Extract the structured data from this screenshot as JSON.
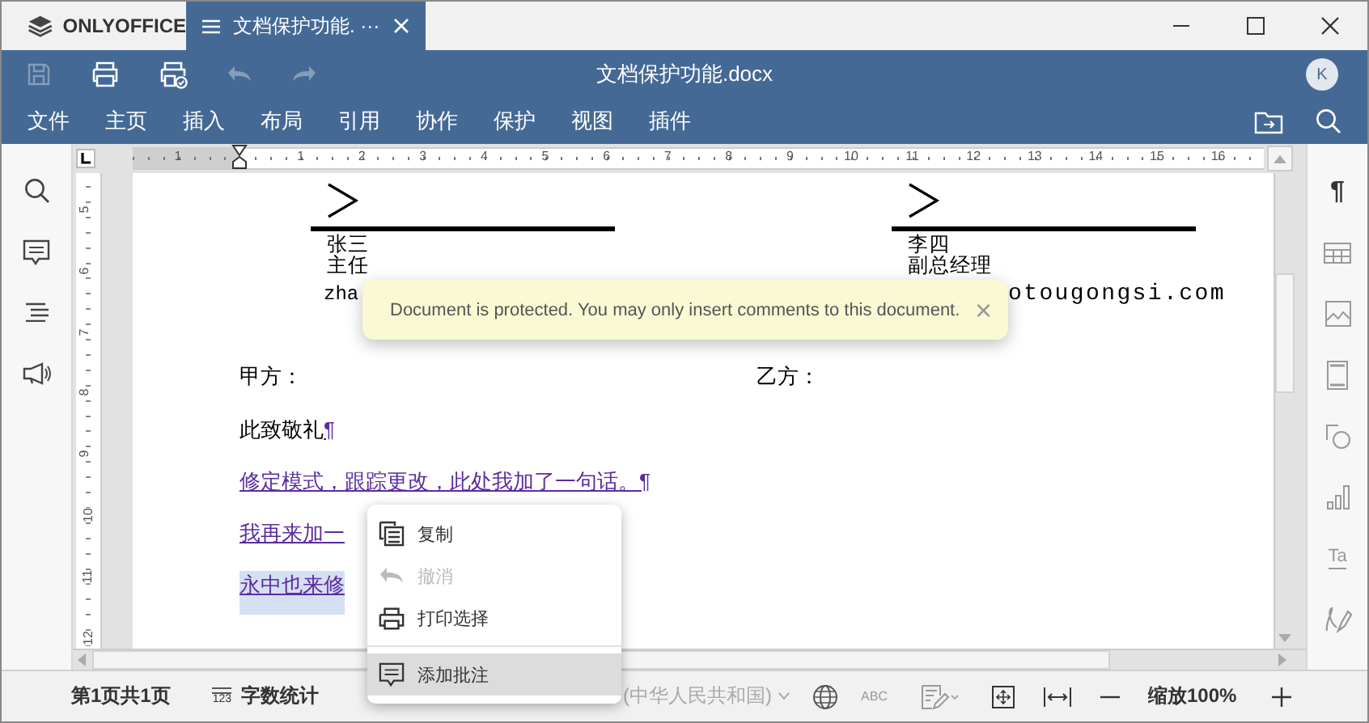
{
  "app": {
    "logo": "ONLYOFFICE"
  },
  "tabs": [
    {
      "label": "文档保护功能. ···",
      "selected": true
    }
  ],
  "toolbar": {
    "title": "文档保护功能.docx",
    "avatar": "K",
    "buttons": [
      {
        "kind": "save",
        "disabled": true
      },
      {
        "kind": "print",
        "disabled": false
      },
      {
        "kind": "quickprint",
        "disabled": false
      },
      {
        "kind": "undo",
        "disabled": true
      },
      {
        "kind": "redo",
        "disabled": true
      }
    ]
  },
  "menu": [
    "文件",
    "主页",
    "插入",
    "布局",
    "引用",
    "协作",
    "保护",
    "视图",
    "插件"
  ],
  "rulers": {
    "horizontal": [
      "1",
      "1",
      "2",
      "3",
      "4",
      "5",
      "6",
      "7",
      "8",
      "9",
      "10",
      "11",
      "12",
      "13",
      "14",
      "15",
      "16"
    ],
    "vertical": [
      "5",
      "6",
      "7",
      "8",
      "9",
      "10",
      "11",
      "12"
    ]
  },
  "document": {
    "signatures": [
      {
        "name": "张三",
        "title": "主任",
        "email": "zha"
      },
      {
        "name": "李四",
        "title": "副总经理",
        "email": "otougongsi.com"
      }
    ],
    "parties": [
      "甲方：",
      "乙方："
    ],
    "paragraphs": [
      {
        "text": "此致敬礼",
        "tracked": false,
        "selected": false,
        "pilcrow": "¶"
      },
      {
        "text": "修定模式，跟踪更改，此处我加了一句话。",
        "tracked": true,
        "selected": false,
        "pilcrow": "¶"
      },
      {
        "text": "我再来加一",
        "tracked": true,
        "selected": false
      },
      {
        "text": "永中也来修",
        "tracked": true,
        "selected": true
      }
    ]
  },
  "toast": {
    "message": "Document is protected. You may only insert comments to this document.",
    "close": "×"
  },
  "context_menu": [
    {
      "kind": "copy",
      "label": "复制",
      "disabled": false,
      "selected": false,
      "separated": false
    },
    {
      "kind": "undo",
      "label": "撤消",
      "disabled": true,
      "selected": false,
      "separated": false
    },
    {
      "kind": "print",
      "label": "打印选择",
      "disabled": false,
      "selected": false,
      "separated": false
    },
    {
      "kind": "comment",
      "label": "添加批注",
      "disabled": false,
      "selected": true,
      "separated": true
    }
  ],
  "right_panel": [
    {
      "kind": "paragraph",
      "label": "¶"
    },
    {
      "kind": "table"
    },
    {
      "kind": "image"
    },
    {
      "kind": "header"
    },
    {
      "kind": "shape"
    },
    {
      "kind": "chart"
    },
    {
      "kind": "textart",
      "label": "Ta"
    },
    {
      "kind": "signature"
    }
  ],
  "status_bar": {
    "page": "第1页共1页",
    "word_count_icon": "123",
    "word_count": "字数统计",
    "language": "(中华人民共和国)",
    "spell_icon": "ABC",
    "zoom": "缩放100%"
  }
}
